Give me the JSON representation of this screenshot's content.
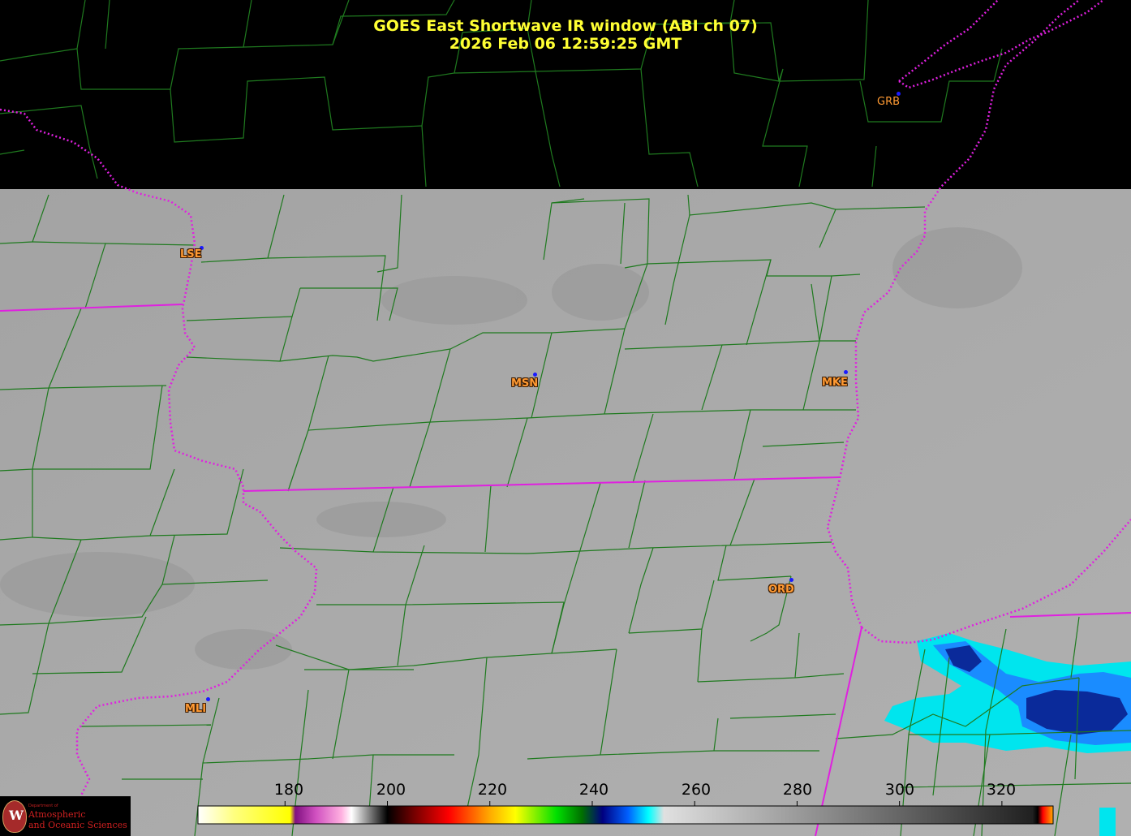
{
  "title": {
    "line1": "GOES East Shortwave IR window (ABI ch 07)",
    "line2": "2026 Feb 06  12:59:25 GMT"
  },
  "stations": [
    {
      "id": "GRB",
      "style": "plain"
    },
    {
      "id": "LSE",
      "style": "outlined"
    },
    {
      "id": "MSN",
      "style": "outlined"
    },
    {
      "id": "MKE",
      "style": "outlined"
    },
    {
      "id": "ORD",
      "style": "outlined"
    },
    {
      "id": "MLI",
      "style": "outlined"
    }
  ],
  "colorbar": {
    "ticks": [
      "180",
      "200",
      "220",
      "240",
      "260",
      "280",
      "300",
      "320"
    ],
    "range": [
      163,
      330
    ],
    "stops": [
      {
        "v": 163,
        "color": "#ffffff"
      },
      {
        "v": 170,
        "color": "#ffff80"
      },
      {
        "v": 181,
        "color": "#ffff00"
      },
      {
        "v": 182,
        "color": "#801080"
      },
      {
        "v": 186,
        "color": "#d050c0"
      },
      {
        "v": 191,
        "color": "#ffb0e0"
      },
      {
        "v": 193,
        "color": "#ffffff"
      },
      {
        "v": 200,
        "color": "#000000"
      },
      {
        "v": 205,
        "color": "#700000"
      },
      {
        "v": 212,
        "color": "#ff0000"
      },
      {
        "v": 220,
        "color": "#ffaa00"
      },
      {
        "v": 225,
        "color": "#ffff00"
      },
      {
        "v": 233,
        "color": "#00e000"
      },
      {
        "v": 238,
        "color": "#007000"
      },
      {
        "v": 242,
        "color": "#000080"
      },
      {
        "v": 247,
        "color": "#0060ff"
      },
      {
        "v": 251,
        "color": "#00ffff"
      },
      {
        "v": 254,
        "color": "#e0e0e0"
      },
      {
        "v": 326,
        "color": "#202020"
      },
      {
        "v": 327,
        "color": "#000000"
      },
      {
        "v": 328,
        "color": "#ff0000"
      },
      {
        "v": 330,
        "color": "#ffaa00"
      }
    ]
  },
  "colors": {
    "ir_gray": "#a7a7a7",
    "county_lines": "#1f7a1f",
    "state_lines": "#e020e0",
    "title": "#ffff33",
    "station_label": "#ff9a33",
    "station_dot": "#1a1aff"
  },
  "logo": {
    "dept": "Department of",
    "name1": "Atmospheric",
    "name2": "and Oceanic Sciences",
    "seal_letter": "W"
  }
}
